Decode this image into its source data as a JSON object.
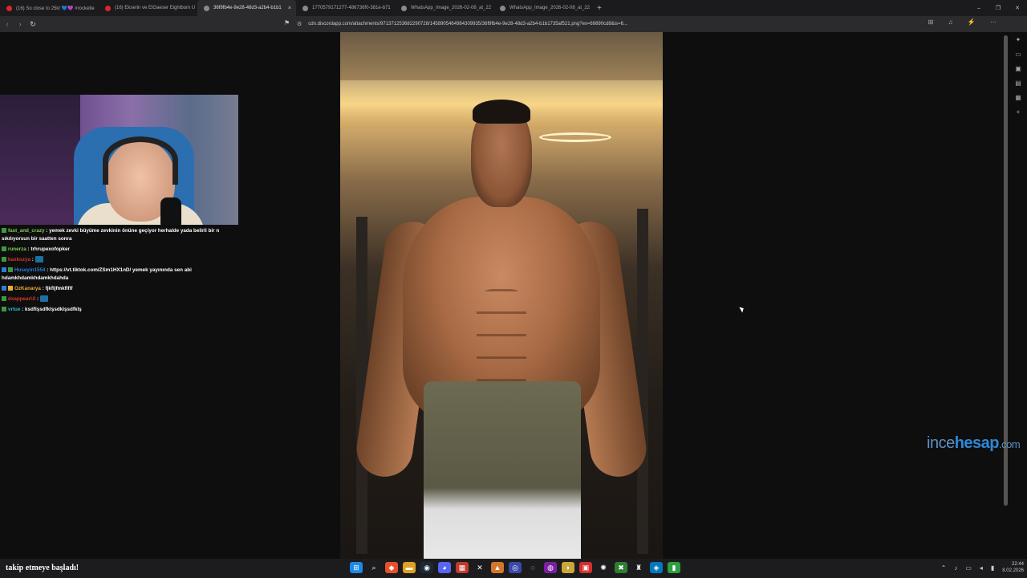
{
  "browser": {
    "tabs": [
      {
        "title": "(16) So close to 25k! 💙💜 #rocketle",
        "color": "#e0242c",
        "active": false
      },
      {
        "title": "(16) Ekserin ve ElGaeser Eightbom U",
        "color": "#e0242c",
        "active": false
      },
      {
        "title": "36f9fb4e-9e28-48d3-a2b4-b1b1",
        "color": "#8a8a8a",
        "active": true
      },
      {
        "title": "1770579171277-486736f0-381e-b71",
        "color": "#8a8a8a",
        "active": false
      },
      {
        "title": "WhatsApp_Image_2026-02-08_at_22",
        "color": "#8a8a8a",
        "active": false
      },
      {
        "title": "WhatsApp_Image_2026-02-08_at_22",
        "color": "#8a8a8a",
        "active": false
      }
    ],
    "new_tab": "+",
    "close_tab": "×",
    "url": "cdn.discordapp.com/attachments/971371253682290728/1458905464984309935/36f9fb4e-9e28-48d3-a2b4-b1b1735af521.png?ex=69890cd8&is=6...",
    "window_controls": {
      "minimize": "–",
      "restore": "❐",
      "close": "✕"
    },
    "nav": {
      "back": "‹",
      "forward": "›",
      "reload": "↻"
    }
  },
  "chat": {
    "messages": [
      {
        "user": "fast_and_crazy",
        "color": "#7fd14d",
        "text": " : yemek zevki büyüme zevkinin önüne geçiyor herhalde yada belirli bir n sıkılıyorsun bir saatten sonra",
        "emote": false
      },
      {
        "user": "runerza",
        "color": "#7fd14d",
        "text": " : trhrupexofopker",
        "emote": false
      },
      {
        "user": "kaxkozya",
        "color": "#d03a2b",
        "text": " : ",
        "emote": true
      },
      {
        "user": "Huseyin1554",
        "color": "#2a7fd8",
        "text": " : https://vt.tiktok.com/ZSm1HX1nD/ yemek yayınında sen abi hdamkhdamkhdamkhdahda",
        "emote": false
      },
      {
        "user": "OzKanarya",
        "color": "#e8b030",
        "text": " : fjkfljfmkflflf",
        "emote": false
      },
      {
        "user": "dxappearUI",
        "color": "#d03a2b",
        "text": " : ",
        "emote": true
      },
      {
        "user": "vrtue",
        "color": "#2fb8c8",
        "text": " : ksdflşsdfklşsdklşsdfklş",
        "emote": false
      }
    ]
  },
  "alert": {
    "user": "",
    "text": "takip etmeye başladı!"
  },
  "watermark": {
    "part1": "ince",
    "part2": "hesap",
    "part3": ".com"
  },
  "taskbar": {
    "time": "22:44",
    "date": "8.02.2026"
  }
}
